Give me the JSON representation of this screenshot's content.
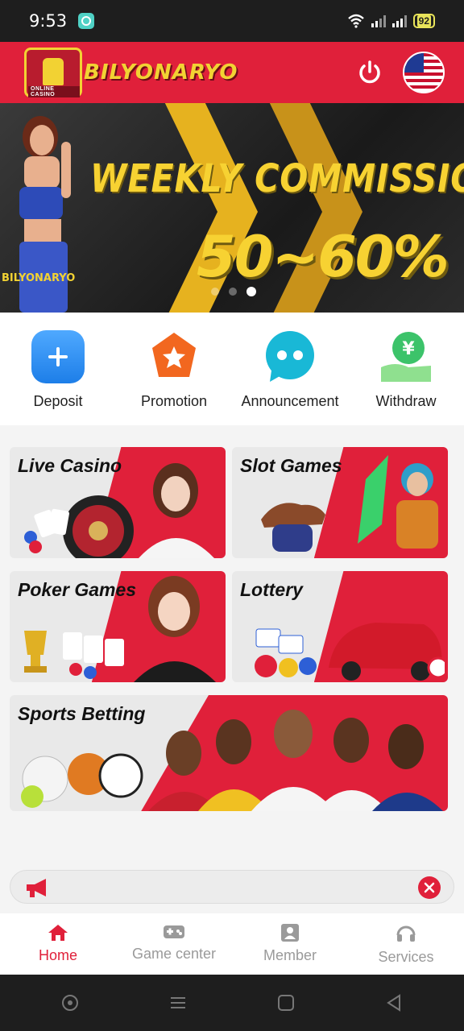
{
  "status_bar": {
    "time": "9:53",
    "battery": "92"
  },
  "header": {
    "logo_text": "BILYONARYO",
    "logo_sub": "ONLINE CASINO"
  },
  "banner": {
    "title": "WEEKLY COMMISSION",
    "percent": "50~60%",
    "small_logo": "BILYONARYO",
    "slide_count": 3,
    "active_slide": 3
  },
  "quick_actions": [
    {
      "label": "Deposit",
      "icon": "plus-icon",
      "color": "#2e8cf0"
    },
    {
      "label": "Promotion",
      "icon": "star-badge-icon",
      "color": "#f2671f"
    },
    {
      "label": "Announcement",
      "icon": "chat-bubble-icon",
      "color": "#19b8d6"
    },
    {
      "label": "Withdraw",
      "icon": "yen-hand-icon",
      "color": "#3cc36a"
    }
  ],
  "games": {
    "live_casino": "Live Casino",
    "slot_games": "Slot Games",
    "poker_games": "Poker Games",
    "lottery": "Lottery",
    "sports_betting": "Sports Betting"
  },
  "marquee": {
    "icon": "megaphone-icon",
    "text": ""
  },
  "bottom_nav": [
    {
      "label": "Home",
      "icon": "home-icon",
      "active": true
    },
    {
      "label": "Game center",
      "icon": "gamepad-icon",
      "active": false
    },
    {
      "label": "Member",
      "icon": "member-icon",
      "active": false
    },
    {
      "label": "Services",
      "icon": "headset-icon",
      "active": false
    }
  ],
  "colors": {
    "brand_red": "#e0203a",
    "gold": "#f2d233",
    "inactive_gray": "#9a9a9a"
  }
}
